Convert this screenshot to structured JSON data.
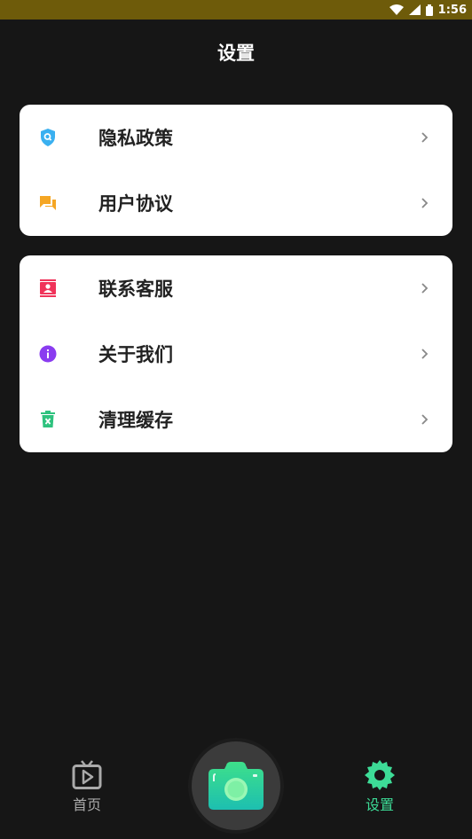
{
  "status_bar": {
    "time": "1:56"
  },
  "header": {
    "title": "设置"
  },
  "card1": {
    "items": [
      {
        "label": "隐私政策",
        "icon": "privacy-shield-icon",
        "color": "#3ab0f0"
      },
      {
        "label": "用户协议",
        "icon": "chat-bubbles-icon",
        "color": "#f5a623"
      }
    ]
  },
  "card2": {
    "items": [
      {
        "label": "联系客服",
        "icon": "contact-card-icon",
        "color": "#f0335a"
      },
      {
        "label": "关于我们",
        "icon": "info-icon",
        "color": "#8a3cf0"
      },
      {
        "label": "清理缓存",
        "icon": "trash-icon",
        "color": "#2ec27e"
      }
    ]
  },
  "bottom_nav": {
    "home_label": "首页",
    "settings_label": "设置",
    "active_color": "#3ddc97",
    "inactive_color": "#aaaaaa"
  }
}
